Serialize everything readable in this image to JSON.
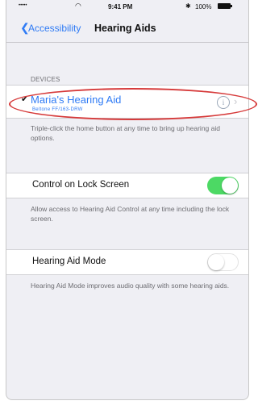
{
  "status_bar": {
    "signal": "•••••",
    "wifi": "wifi-icon",
    "time": "9:41 PM",
    "bluetooth": "bluetooth-icon",
    "battery_percent": "100%"
  },
  "nav": {
    "back_label": "Accessibility",
    "title": "Hearing Aids"
  },
  "devices": {
    "header": "DEVICES",
    "device_name": "Maria's Hearing Aid",
    "device_model": "Beltone FF/163-DRW",
    "footer": "Triple-click the home button at any time to bring up hearing aid options."
  },
  "lock_screen": {
    "label": "Control on Lock Screen",
    "enabled": true,
    "footer": "Allow access to Hearing Aid Control at any time including the lock screen."
  },
  "hearing_aid_mode": {
    "label": "Hearing Aid Mode",
    "enabled": false,
    "footer": "Hearing Aid Mode improves audio quality with some hearing aids."
  },
  "colors": {
    "accent": "#2f7bf5",
    "switch_on": "#4cd964",
    "annotation": "#d63a3a",
    "background": "#efeff4"
  }
}
